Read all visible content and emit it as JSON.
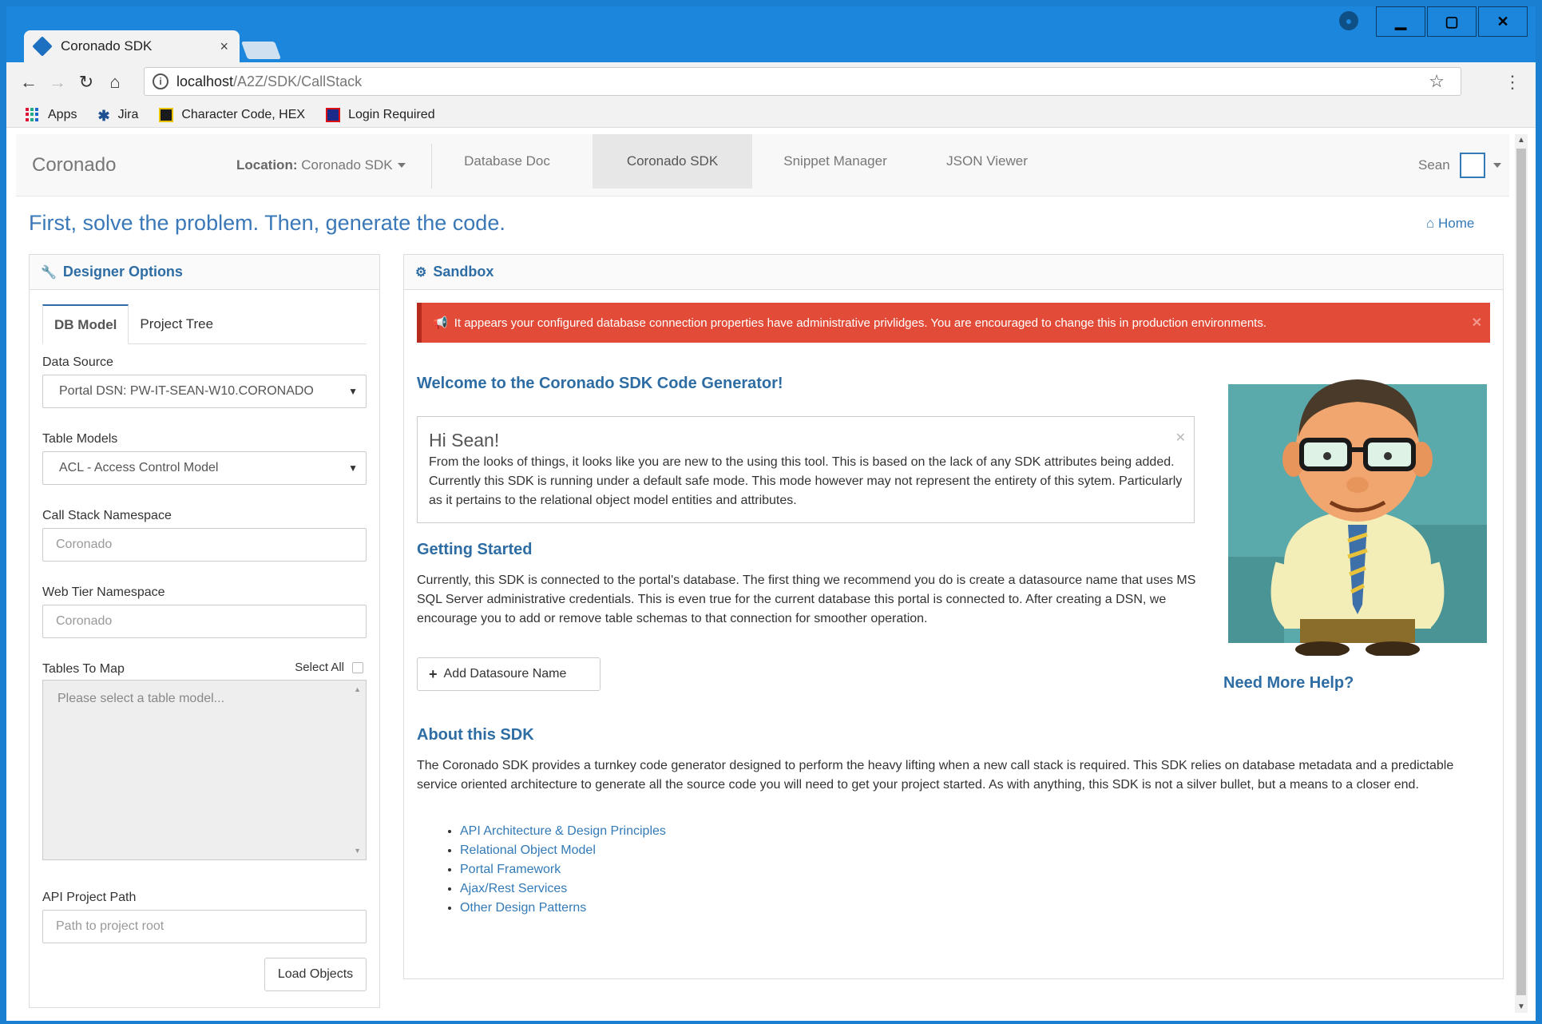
{
  "browser": {
    "tab_title": "Coronado SDK",
    "tab_close": "×",
    "url_host": "localhost",
    "url_path": "/A2Z/SDK/CallStack",
    "bookmarks": [
      {
        "label": "Apps"
      },
      {
        "label": "Jira"
      },
      {
        "label": "Character Code, HEX"
      },
      {
        "label": "Login Required"
      }
    ]
  },
  "navbar": {
    "brand": "Coronado",
    "location_label": "Location:",
    "location_value": "Coronado SDK",
    "links": [
      "Database Doc",
      "Coronado SDK",
      "Snippet Manager",
      "JSON Viewer"
    ],
    "active_link": "Coronado SDK",
    "user": "Sean"
  },
  "page": {
    "tagline": "First, solve the problem. Then, generate the code.",
    "home_link": "Home"
  },
  "designer": {
    "title": "Designer Options",
    "tabs": [
      "DB Model",
      "Project Tree"
    ],
    "data_source_label": "Data Source",
    "data_source_value": "Portal DSN: PW-IT-SEAN-W10.CORONADO",
    "table_models_label": "Table Models",
    "table_models_value": "ACL - Access Control Model",
    "call_stack_label": "Call Stack Namespace",
    "call_stack_placeholder": "Coronado",
    "web_tier_label": "Web Tier Namespace",
    "web_tier_placeholder": "Coronado",
    "tables_to_map_label": "Tables To Map",
    "select_all_label": "Select All",
    "tables_placeholder": "Please select a table model...",
    "api_path_label": "API Project Path",
    "api_path_placeholder": "Path to project root",
    "load_button": "Load Objects"
  },
  "sandbox": {
    "title": "Sandbox",
    "alert": "It appears your configured database connection properties have administrative privlidges. You are encouraged to change this in production environments.",
    "welcome_heading": "Welcome to the Coronado SDK Code Generator!",
    "hi_title": "Hi Sean!",
    "hi_text": "From the looks of things, it looks like you are new to the using this tool. This is based on the lack of any SDK attributes being added. Currently this SDK is running under a default safe mode. This mode however may not represent the entirety of this sytem. Particularly as it pertains to the relational object model entities and attributes.",
    "getting_started_heading": "Getting Started",
    "getting_started_text": "Currently, this SDK is connected to the portal's database. The first thing we recommend you do is create a datasource name that uses MS SQL Server administrative credentials. This is even true for the current database this portal is connected to. After creating a DSN, we encourage you to add or remove table schemas to that connection for smoother operation.",
    "add_button": "Add Datasoure Name",
    "about_heading": "About this SDK",
    "about_text": "The Coronado SDK provides a turnkey code generator designed to perform the heavy lifting when a new call stack is required. This SDK relies on database metadata and a predictable service oriented architecture to generate all the source code you will need to get your project started. As with anything, this SDK is not a silver bullet, but a means to a closer end.",
    "links": [
      "API Architecture & Design Principles",
      "Relational Object Model",
      "Portal Framework",
      "Ajax/Rest Services",
      "Other Design Patterns"
    ],
    "help_link": "Need More Help?"
  },
  "colors": {
    "brand_blue": "#2e6da4",
    "link_blue": "#337ab7",
    "alert_red": "#e24b37",
    "chrome_blue": "#1c86dc"
  }
}
